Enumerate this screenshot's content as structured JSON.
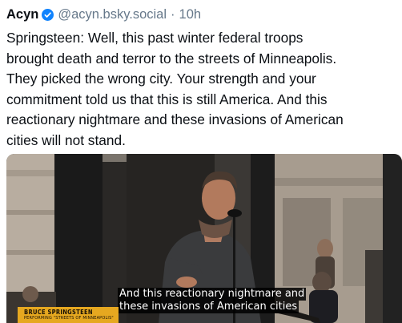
{
  "post": {
    "author_name": "Acyn",
    "handle": "@acyn.bsky.social",
    "separator": "·",
    "time": "10h",
    "verified_icon": "verified-check-icon",
    "text": "Springsteen: Well, this past winter federal troops\nbrought death and terror to the streets of Minneapolis.\nThey picked the wrong city. Your strength and your\ncommitment told us that this is still America. And this\nreactionary nightmare and these invasions of American\ncities will not stand."
  },
  "media": {
    "caption_lines": [
      "And this reactionary nightmare and",
      "these invasions of American cities"
    ],
    "lower_third": {
      "name": "BRUCE SPRINGSTEEN",
      "subtitle": "PERFORMING \"STREETS OF MINNEAPOLIS\""
    }
  },
  "colors": {
    "verified": "#1083fe",
    "muted": "#66788a",
    "lower_third_bg": "#e6a820"
  }
}
